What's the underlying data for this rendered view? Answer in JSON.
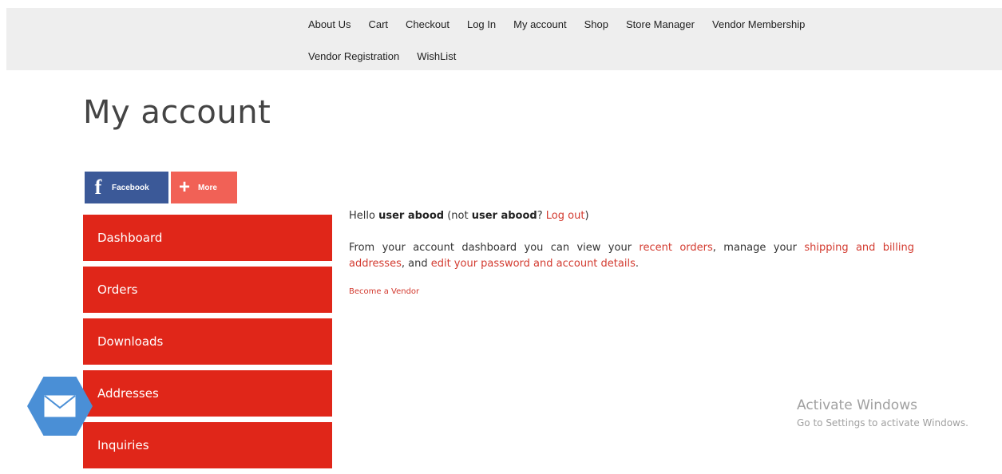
{
  "nav": {
    "row1": [
      "About Us",
      "Cart",
      "Checkout",
      "Log In",
      "My account",
      "Shop",
      "Store Manager",
      "Vendor Membership"
    ],
    "row2": [
      "Vendor Registration",
      "WishList"
    ]
  },
  "page_title": "My account",
  "share": {
    "facebook_label": "Facebook",
    "more_label": "More",
    "facebook_icon": "facebook-f-icon",
    "more_icon": "plus-icon",
    "facebook_color": "#3b5998",
    "more_color": "#f16156"
  },
  "menu": [
    "Dashboard",
    "Orders",
    "Downloads",
    "Addresses",
    "Inquiries"
  ],
  "menu_color": "#e02619",
  "content": {
    "hello_prefix": "Hello ",
    "user": "user abood",
    "not_prefix": " (not ",
    "user2": "user abood",
    "q": "? ",
    "logout": "Log out",
    "close_paren": ")",
    "desc1": "From your account dashboard you can view your ",
    "recent_orders": "recent orders",
    "desc2": ", manage your ",
    "shipping": "shipping and billing addresses",
    "desc3": ", and ",
    "edit_link": "edit your password and account details",
    "desc4": ".",
    "become_vendor": "Become a Vendor"
  },
  "link_color": "#d33a2f",
  "mail_icon": "envelope-icon",
  "watermark": {
    "line1": "Activate Windows",
    "line2": "Go to Settings to activate Windows."
  }
}
